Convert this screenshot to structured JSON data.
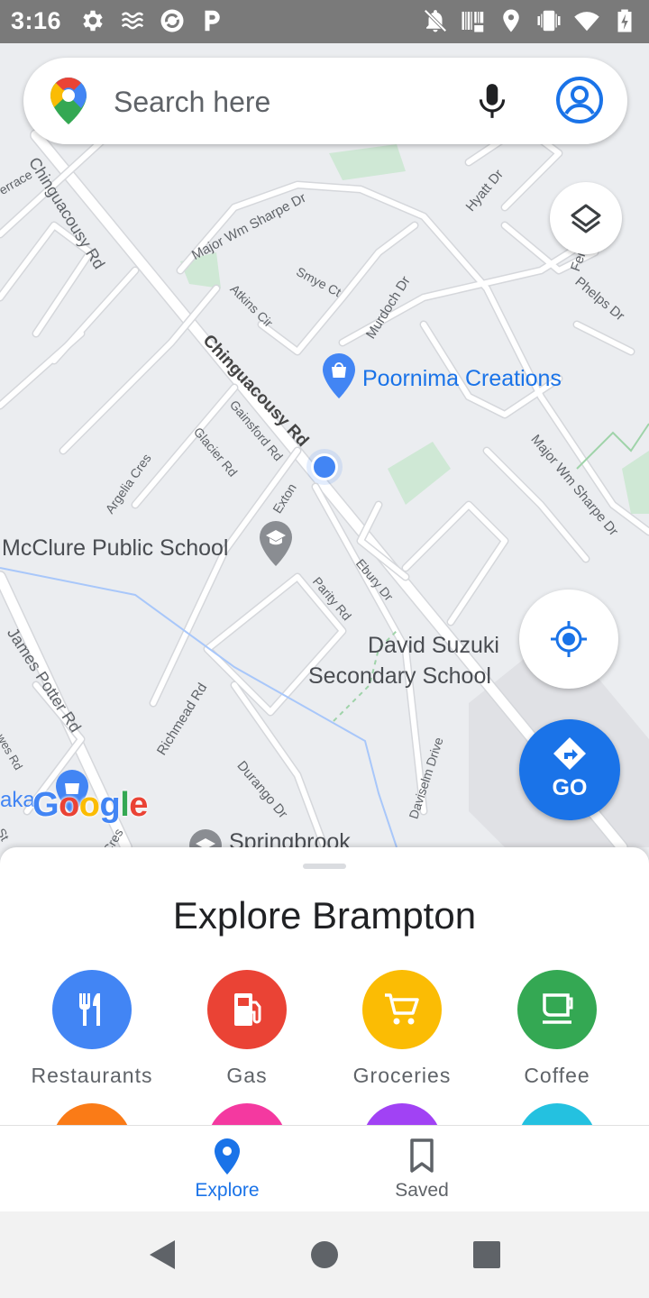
{
  "status_bar": {
    "time": "3:16",
    "left_icons": [
      "settings-icon",
      "wind-icon",
      "sync-icon",
      "parking-icon"
    ],
    "right_icons": [
      "notifications-off-icon",
      "barcode-icon",
      "location-icon",
      "vibrate-icon",
      "wifi-icon",
      "battery-icon"
    ]
  },
  "search": {
    "placeholder": "Search here",
    "icons": [
      "maps-logo-icon",
      "microphone-icon",
      "account-icon"
    ]
  },
  "map": {
    "roads": [
      "Chinguacousy Rd",
      "Chinguacousy Rd",
      "Major Wm Sharpe Dr",
      "Major Wm Sharpe Dr",
      "Smye Ct",
      "Atkins Cir",
      "Murdoch Dr",
      "Hyatt Dr",
      "Phelps Dr",
      "Gainsford Rd",
      "Glacier Rd",
      "Argelia Cres",
      "Exton",
      "Parity Rd",
      "Ebury Dr",
      "James Potter Rd",
      "Richmead Rd",
      "Durango Dr",
      "Daviselm Drive",
      "Fern Ave",
      "errace",
      "wes Rd",
      "n Cres",
      "St"
    ],
    "places": {
      "poornima": "Poornima Creations",
      "mcclure": "McClure Public School",
      "suzuki_line1": "David Suzuki",
      "suzuki_line2": "Secondary School",
      "springbrook": "Springbrook",
      "aka": "aka"
    },
    "google": [
      "G",
      "o",
      "o",
      "g",
      "l",
      "e"
    ]
  },
  "buttons": {
    "go_label": "GO"
  },
  "sheet": {
    "title": "Explore Brampton",
    "categories": [
      {
        "label": "Restaurants",
        "color": "#4285f4",
        "icon": "restaurant-icon"
      },
      {
        "label": "Gas",
        "color": "#ea4335",
        "icon": "gas-station-icon"
      },
      {
        "label": "Groceries",
        "color": "#fbbc04",
        "icon": "cart-icon"
      },
      {
        "label": "Coffee",
        "color": "#34a853",
        "icon": "coffee-icon"
      }
    ],
    "next_row_colors": [
      "#fa7b17",
      "#f439a0",
      "#a142f4",
      "#24c1e0"
    ]
  },
  "bottom_nav": {
    "explore": "Explore",
    "saved": "Saved",
    "active_color": "#1a73e8"
  }
}
